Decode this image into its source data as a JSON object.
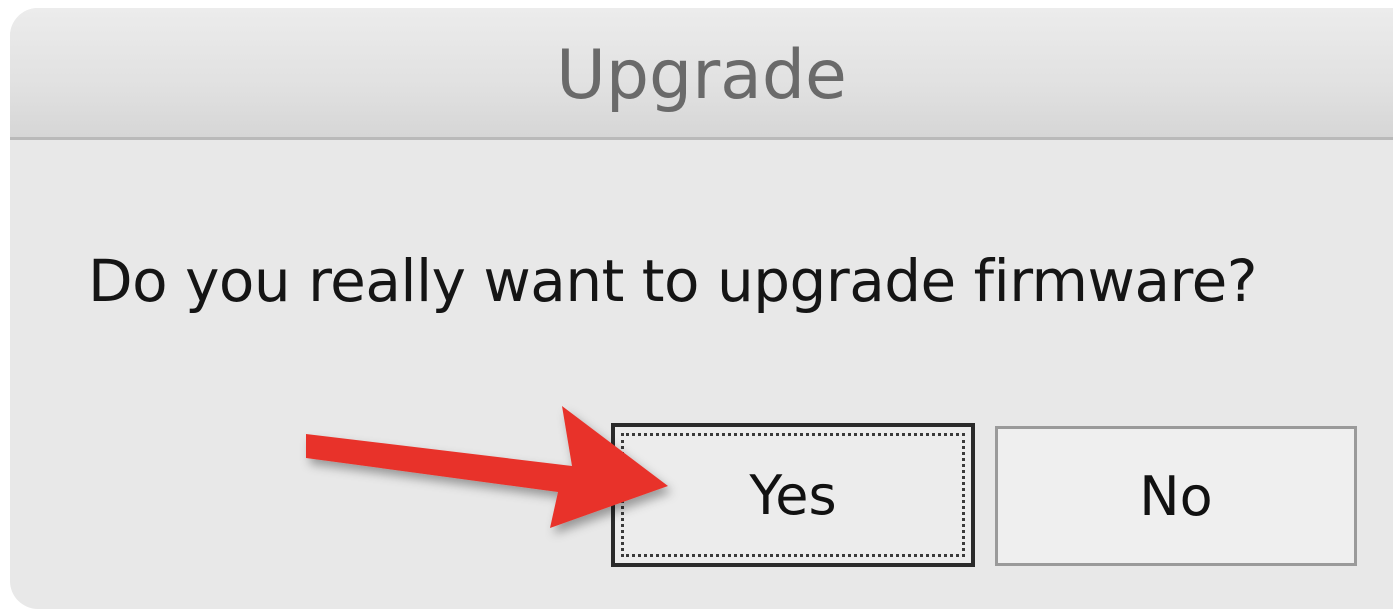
{
  "dialog": {
    "title": "Upgrade",
    "message": "Do you really want to upgrade firmware?",
    "buttons": {
      "yes_label": "Yes",
      "no_label": "No"
    }
  },
  "annotation": {
    "arrow_color": "#e8332a",
    "arrow_icon": "red-arrow-icon"
  }
}
